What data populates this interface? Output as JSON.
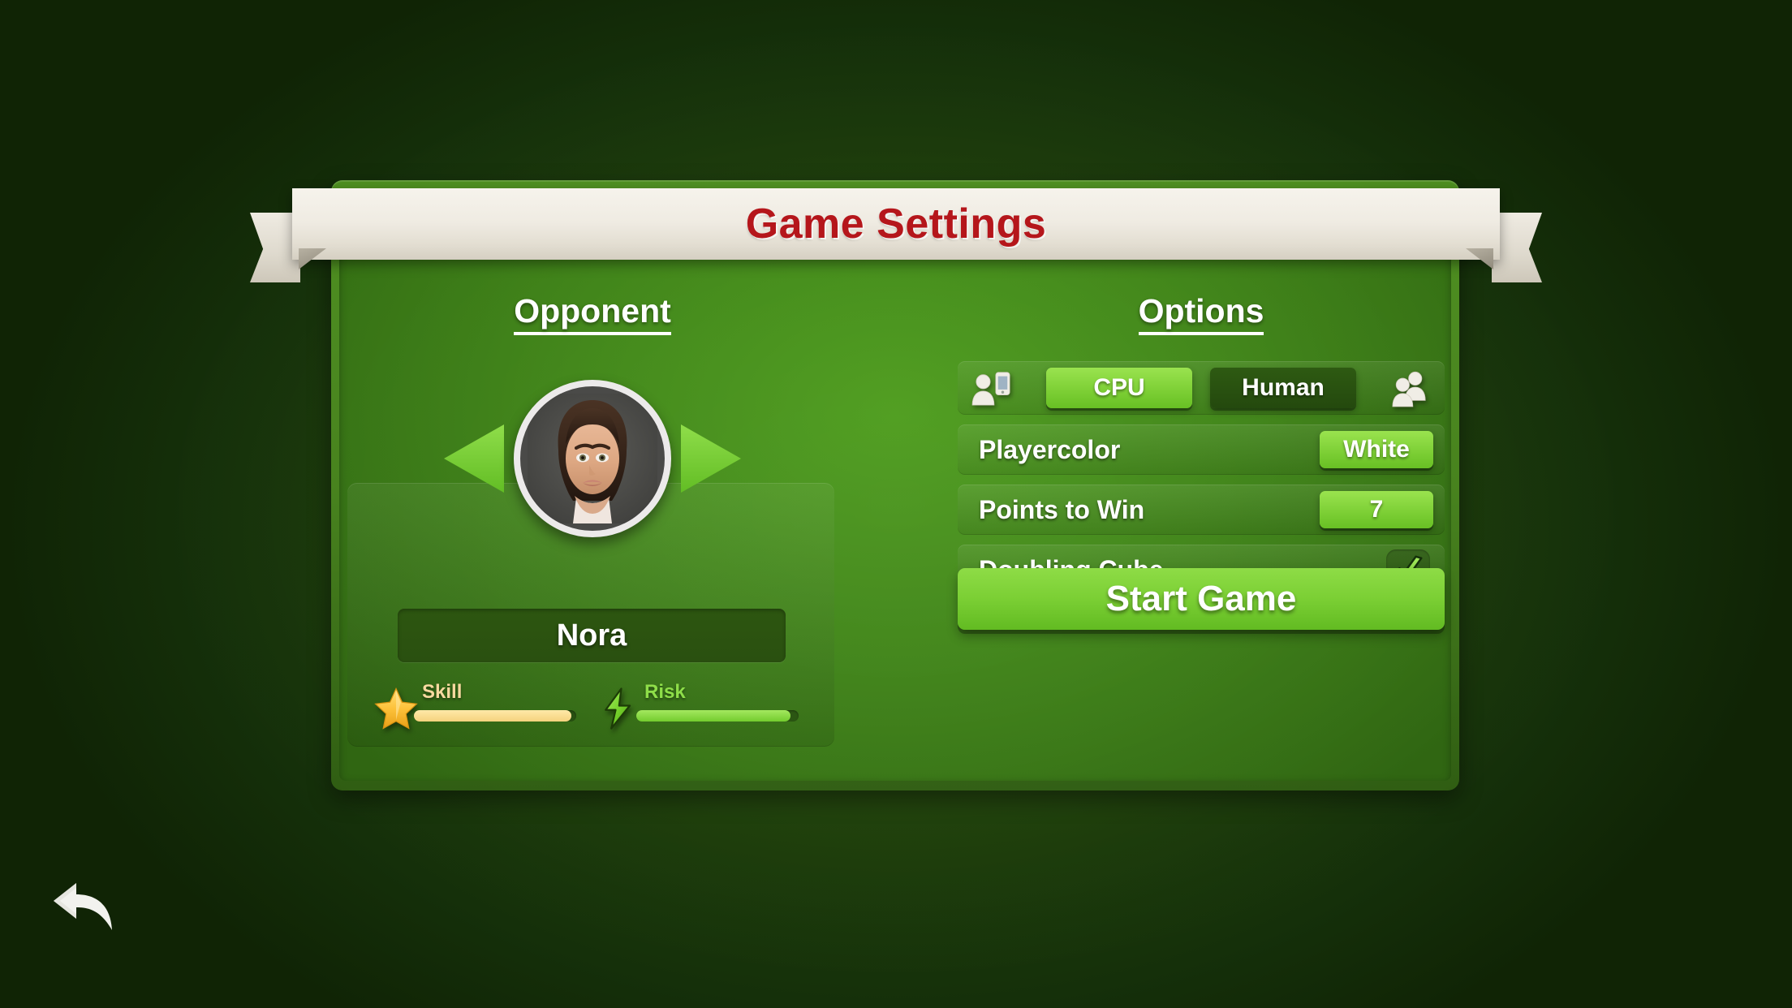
{
  "window": {
    "title": "Game Settings",
    "background_color": "#1e4009",
    "panel_color": "#46821c"
  },
  "header": {
    "title": "Game Settings",
    "title_color": "#b5161b",
    "banner_color": "#efebe2"
  },
  "opponent": {
    "section_title": "Opponent",
    "prev_arrow_icon": "triangle-left-icon",
    "next_arrow_icon": "triangle-right-icon",
    "avatar_icon": "female-avatar-portrait",
    "name": "Nora",
    "stats": [
      {
        "label": "Skill",
        "icon": "star-icon",
        "value": 97,
        "max": 100,
        "bar_color": "#f5d27d",
        "label_color": "#f7d9a0"
      },
      {
        "label": "Risk",
        "icon": "lightning-bolt-icon",
        "value": 95,
        "max": 100,
        "bar_color": "#73cc2e",
        "label_color": "#8ede49"
      }
    ]
  },
  "options": {
    "section_title": "Options",
    "opponent_type": {
      "left_icon": "person-with-phone-icon",
      "right_icon": "two-people-icon",
      "choices": [
        "CPU",
        "Human"
      ],
      "selected": "CPU"
    },
    "rows": [
      {
        "label": "Playercolor",
        "value": "White",
        "control": "button"
      },
      {
        "label": "Points to Win",
        "value": "7",
        "control": "button"
      },
      {
        "label": "Doubling Cube",
        "value": "checked",
        "control": "checkbox",
        "checkmark_icon": "check-icon"
      }
    ],
    "start_button": {
      "label": "Start Game",
      "color": "#7bcf34"
    }
  },
  "navigation": {
    "back_button_icon": "back-arrow-icon",
    "back_button_color": "#f2f2ee"
  }
}
